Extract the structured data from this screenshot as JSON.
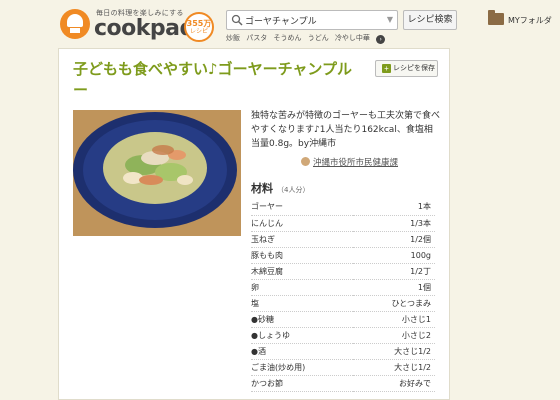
{
  "header": {
    "tagline": "毎日の料理を楽しみにする",
    "brand": "cookpad",
    "recipe_count": "355万",
    "recipe_count_unit": "レシピ",
    "search_value": "ゴーヤチャンプル",
    "search_button": "レシピ検索",
    "keywords": [
      "炒飯",
      "パスタ",
      "そうめん",
      "うどん",
      "冷やし中華"
    ],
    "more_icon": "chevron-right-icon",
    "myfolder_label": "MYフォルダ"
  },
  "recipe": {
    "title": "子どもも食べやすい♪ゴーヤーチャンプルー",
    "save_label": "レシピを保存",
    "description": "独特な苦みが特徴のゴーヤーも工夫次第で食べやすくなります♪1人当たり162kcal、食塩相当量0.8g。by沖縄市",
    "author": "沖縄市役所市民健康課",
    "ingredients_heading": "材料",
    "servings": "（4人分）",
    "ingredients": [
      {
        "name": "ゴーヤー",
        "qty": "1本"
      },
      {
        "name": "にんじん",
        "qty": "1/3本"
      },
      {
        "name": "玉ねぎ",
        "qty": "1/2個"
      },
      {
        "name": "豚もも肉",
        "qty": "100g"
      },
      {
        "name": "木綿豆腐",
        "qty": "1/2丁"
      },
      {
        "name": "卵",
        "qty": "1個"
      },
      {
        "name": "塩",
        "qty": "ひとつまみ"
      },
      {
        "name": "●砂糖",
        "qty": "小さじ1"
      },
      {
        "name": "●しょうゆ",
        "qty": "小さじ2"
      },
      {
        "name": "●酒",
        "qty": "大さじ1/2"
      },
      {
        "name": "ごま油(炒め用)",
        "qty": "大さじ1/2"
      },
      {
        "name": "かつお節",
        "qty": "お好みで"
      }
    ]
  },
  "colors": {
    "brand_orange": "#f08a24",
    "title_green": "#7e9b1c",
    "page_bg": "#f6f3e6"
  }
}
